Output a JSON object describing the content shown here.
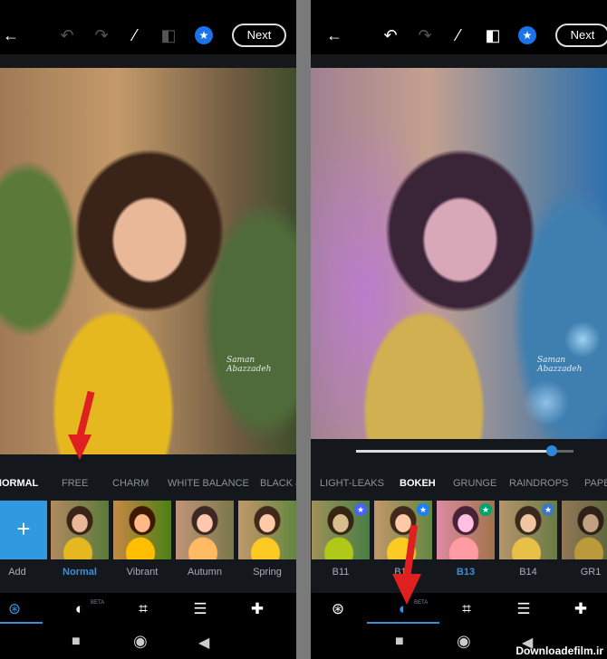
{
  "left_screen": {
    "toolbar": {
      "back": "back-arrow-icon",
      "next_label": "Next"
    },
    "signature": [
      "Saman",
      "Abazzadeh"
    ],
    "category_tabs": [
      "NORMAL",
      "FREE",
      "CHARM",
      "WHITE BALANCE",
      "BLACK &"
    ],
    "active_tab": "NORMAL",
    "add_label": "Add",
    "add_symbol": "+",
    "presets": [
      "Normal",
      "Vibrant",
      "Autumn",
      "Spring"
    ],
    "active_preset": "Normal",
    "beta_label": "BETA"
  },
  "right_screen": {
    "toolbar": {
      "next_label": "Next"
    },
    "signature": [
      "Saman",
      "Abazzadeh"
    ],
    "slider_value": 0.9,
    "category_tabs": [
      "LIGHT-LEAKS",
      "BOKEH",
      "GRUNGE",
      "RAINDROPS",
      "PAPE"
    ],
    "active_tab": "BOKEH",
    "presets": [
      "B11",
      "B12",
      "B13",
      "B14",
      "GR1"
    ],
    "premium_presets": [
      "B11",
      "B12",
      "B13",
      "B14"
    ],
    "active_preset": "B13",
    "beta_label": "BETA"
  },
  "annotation_color": "#e02020",
  "accent_color": "#3b8fd6",
  "watermark": "Downloadefilm.ir"
}
